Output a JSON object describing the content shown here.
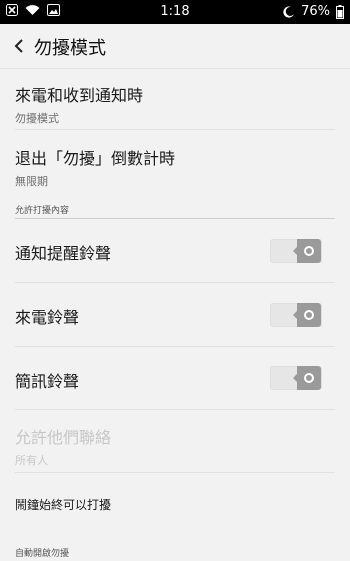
{
  "status": {
    "time": "1:18",
    "battery": "76%"
  },
  "header": {
    "title": "勿擾模式"
  },
  "rows": {
    "incoming": {
      "label": "來電和收到通知時",
      "sub": "勿擾模式"
    },
    "exit": {
      "label": "退出「勿擾」倒數計時",
      "sub": "無限期"
    }
  },
  "section_allow": "允許打擾內容",
  "toggles": {
    "notify": {
      "label": "通知提醒鈴聲",
      "on": false
    },
    "call": {
      "label": "來電鈴聲",
      "on": false
    },
    "sms": {
      "label": "簡訊鈴聲",
      "on": false
    }
  },
  "allow_contacts": {
    "label": "允許他們聯絡",
    "sub": "所有人"
  },
  "alarm_row": {
    "label": "鬧鐘始終可以打擾"
  },
  "section_auto": "自動開啟勿擾"
}
